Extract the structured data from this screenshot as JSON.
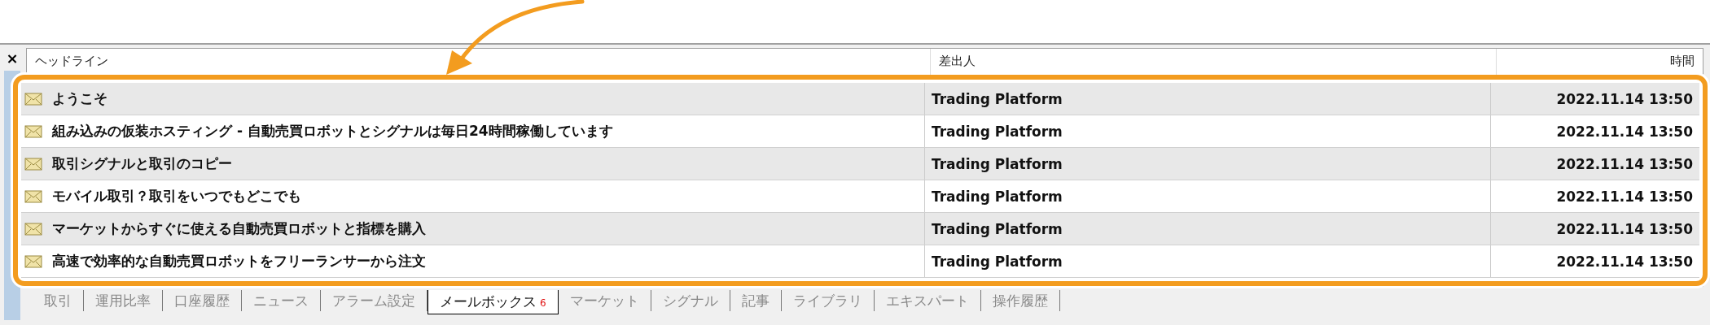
{
  "columns": [
    "ヘッドライン",
    "差出人",
    "時間"
  ],
  "messages": [
    {
      "headline": "ようこそ",
      "sender": "Trading Platform",
      "time": "2022.11.14 13:50"
    },
    {
      "headline": "組み込みの仮装ホスティング - 自動売買ロボットとシグナルは毎日24時間稼働しています",
      "sender": "Trading Platform",
      "time": "2022.11.14 13:50"
    },
    {
      "headline": "取引シグナルと取引のコピー",
      "sender": "Trading Platform",
      "time": "2022.11.14 13:50"
    },
    {
      "headline": "モバイル取引？取引をいつでもどこでも",
      "sender": "Trading Platform",
      "time": "2022.11.14 13:50"
    },
    {
      "headline": "マーケットからすぐに使える自動売買ロボットと指標を購入",
      "sender": "Trading Platform",
      "time": "2022.11.14 13:50"
    },
    {
      "headline": "高速で効率的な自動売買ロボットをフリーランサーから注文",
      "sender": "Trading Platform",
      "time": "2022.11.14 13:50"
    }
  ],
  "close_glyph": "×",
  "tabs": [
    {
      "label": "取引",
      "selected": false
    },
    {
      "label": "運用比率",
      "selected": false
    },
    {
      "label": "口座履歴",
      "selected": false
    },
    {
      "label": "ニュース",
      "selected": false
    },
    {
      "label": "アラーム設定",
      "selected": false
    },
    {
      "label": "メールボックス",
      "selected": true,
      "badge": "6"
    },
    {
      "label": "マーケット",
      "selected": false
    },
    {
      "label": "シグナル",
      "selected": false
    },
    {
      "label": "記事",
      "selected": false
    },
    {
      "label": "ライブラリ",
      "selected": false
    },
    {
      "label": "エキスパート",
      "selected": false
    },
    {
      "label": "操作履歴",
      "selected": false
    }
  ]
}
